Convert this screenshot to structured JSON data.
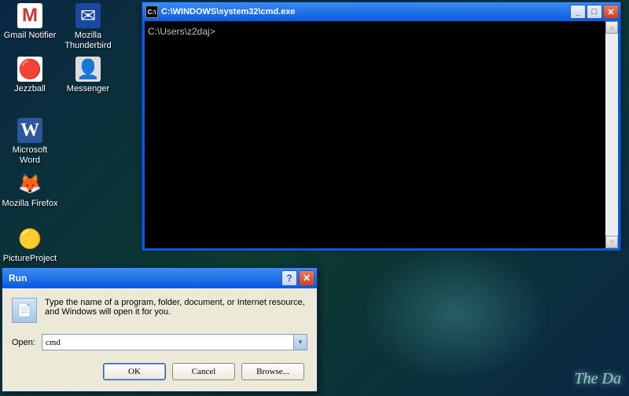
{
  "wallpaper": {
    "corner_text": "The Da"
  },
  "desktop": {
    "icons": [
      {
        "label": "Gmail Notifier",
        "glyph": "M"
      },
      {
        "label": "Mozilla Thunderbird",
        "glyph": "✉"
      },
      {
        "label": "Jezzball",
        "glyph": "🔴"
      },
      {
        "label": "Messenger",
        "glyph": "👤"
      },
      {
        "label": "Microsoft Word",
        "glyph": "W"
      },
      {
        "label": "Mozilla Firefox",
        "glyph": "🦊"
      },
      {
        "label": "PictureProject",
        "glyph": "🟡"
      }
    ]
  },
  "cmd": {
    "title_icon": "C:\\",
    "title": "C:\\WINDOWS\\system32\\cmd.exe",
    "prompt": "C:\\Users\\z2daj>",
    "output": "",
    "buttons": {
      "minimize": "_",
      "maximize": "□",
      "close": "✕"
    },
    "scroll": {
      "up": "▲",
      "down": "▼"
    }
  },
  "run": {
    "title": "Run",
    "help": "?",
    "close": "✕",
    "message": "Type the name of a program, folder, document, or Internet resource, and Windows will open it for you.",
    "open_label": "Open:",
    "value": "cmd",
    "dropdown_glyph": "▼",
    "buttons": {
      "ok": "OK",
      "cancel": "Cancel",
      "browse": "Browse..."
    },
    "icon_glyph": "📄"
  }
}
